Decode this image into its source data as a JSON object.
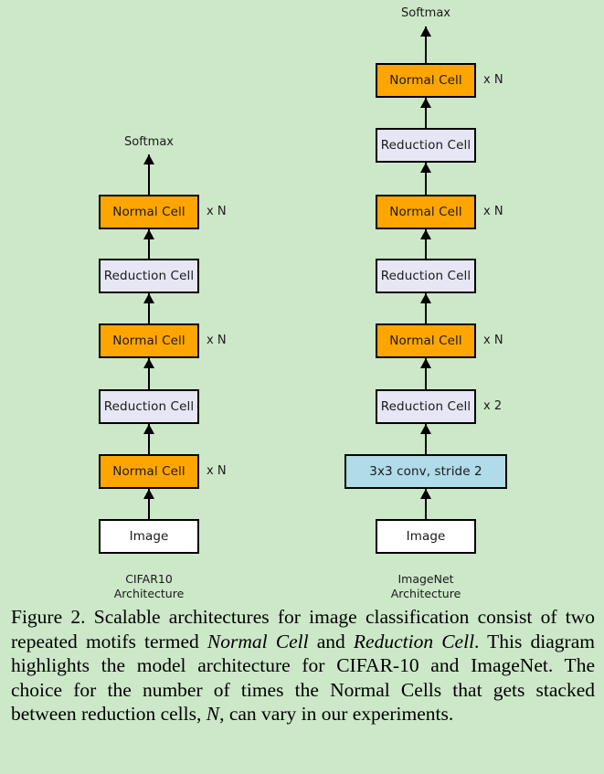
{
  "figure": {
    "background_color": "#cce8c8",
    "colors": {
      "normal_cell": "#ffa500",
      "reduction_cell": "#e6e6f5",
      "conv": "#b0dbe8",
      "image": "#ffffff",
      "stroke": "#000000"
    },
    "columns": [
      {
        "id": "cifar10",
        "arch_label_line1": "CIFAR10",
        "arch_label_line2": "Architecture",
        "top_label": "Softmax",
        "nodes": [
          {
            "label": "Image",
            "type": "image",
            "multiplier": ""
          },
          {
            "label": "Normal Cell",
            "type": "normal",
            "multiplier": "x N"
          },
          {
            "label": "Reduction Cell",
            "type": "reduction",
            "multiplier": ""
          },
          {
            "label": "Normal Cell",
            "type": "normal",
            "multiplier": "x N"
          },
          {
            "label": "Reduction Cell",
            "type": "reduction",
            "multiplier": ""
          },
          {
            "label": "Normal Cell",
            "type": "normal",
            "multiplier": "x N"
          }
        ]
      },
      {
        "id": "imagenet",
        "arch_label_line1": "ImageNet",
        "arch_label_line2": "Architecture",
        "top_label": "Softmax",
        "nodes": [
          {
            "label": "Image",
            "type": "image",
            "multiplier": ""
          },
          {
            "label": "3x3 conv, stride 2",
            "type": "conv",
            "multiplier": ""
          },
          {
            "label": "Reduction Cell",
            "type": "reduction",
            "multiplier": "x 2"
          },
          {
            "label": "Normal Cell",
            "type": "normal",
            "multiplier": "x N"
          },
          {
            "label": "Reduction Cell",
            "type": "reduction",
            "multiplier": ""
          },
          {
            "label": "Normal Cell",
            "type": "normal",
            "multiplier": "x N"
          },
          {
            "label": "Reduction Cell",
            "type": "reduction",
            "multiplier": ""
          },
          {
            "label": "Normal Cell",
            "type": "normal",
            "multiplier": "x N"
          }
        ]
      }
    ]
  },
  "caption": {
    "seg1": "Figure 2. Scalable architectures for image classification consist of two repeated motifs termed ",
    "em1": "Normal Cell",
    "seg2": " and ",
    "em2": "Reduction Cell",
    "seg3": ". This diagram highlights the model architecture for CIFAR-10 and ImageNet. The choice for the number of times the Normal Cells that gets stacked between reduction cells, ",
    "em3": "N",
    "seg4": ", can vary in our experiments."
  }
}
